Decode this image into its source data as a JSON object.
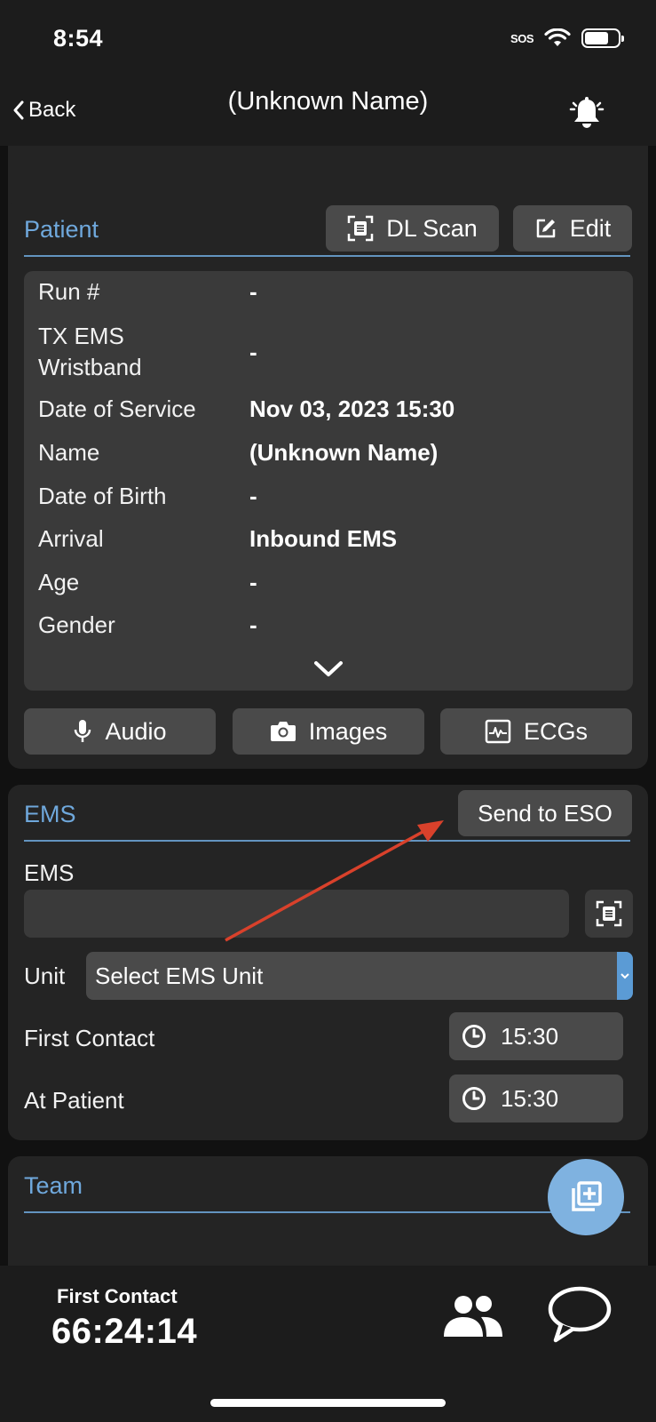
{
  "status_bar": {
    "time": "8:54",
    "sos": "SOS",
    "battery_level": 0.72
  },
  "nav": {
    "back_label": "Back",
    "title": "(Unknown Name)"
  },
  "patient": {
    "title": "Patient",
    "dl_scan_label": "DL Scan",
    "edit_label": "Edit",
    "rows": [
      {
        "label": "Run #",
        "value": "-"
      },
      {
        "label": "TX EMS Wristband",
        "value": "-"
      },
      {
        "label": "Date of Service",
        "value": "Nov 03, 2023 15:30"
      },
      {
        "label": "Name",
        "value": "(Unknown Name)"
      },
      {
        "label": "Date of Birth",
        "value": "-"
      },
      {
        "label": "Arrival",
        "value": "Inbound EMS"
      },
      {
        "label": "Age",
        "value": "-"
      },
      {
        "label": "Gender",
        "value": "-"
      }
    ],
    "media_buttons": {
      "audio": "Audio",
      "images": "Images",
      "ecgs": "ECGs"
    }
  },
  "ems": {
    "title": "EMS",
    "send_button": "Send to ESO",
    "ems_field_label": "EMS",
    "ems_field_value": "",
    "unit_label": "Unit",
    "unit_selected": "Select EMS Unit",
    "first_contact_label": "First Contact",
    "first_contact_time": "15:30",
    "at_patient_label": "At Patient",
    "at_patient_time": "15:30"
  },
  "team": {
    "title": "Team"
  },
  "bottom": {
    "timer_label": "First Contact",
    "timer_value": "66:24:14"
  },
  "colors": {
    "accent": "#6fa8dc",
    "fab": "#7fb2e0",
    "annotation_arrow": "#d9412b"
  }
}
